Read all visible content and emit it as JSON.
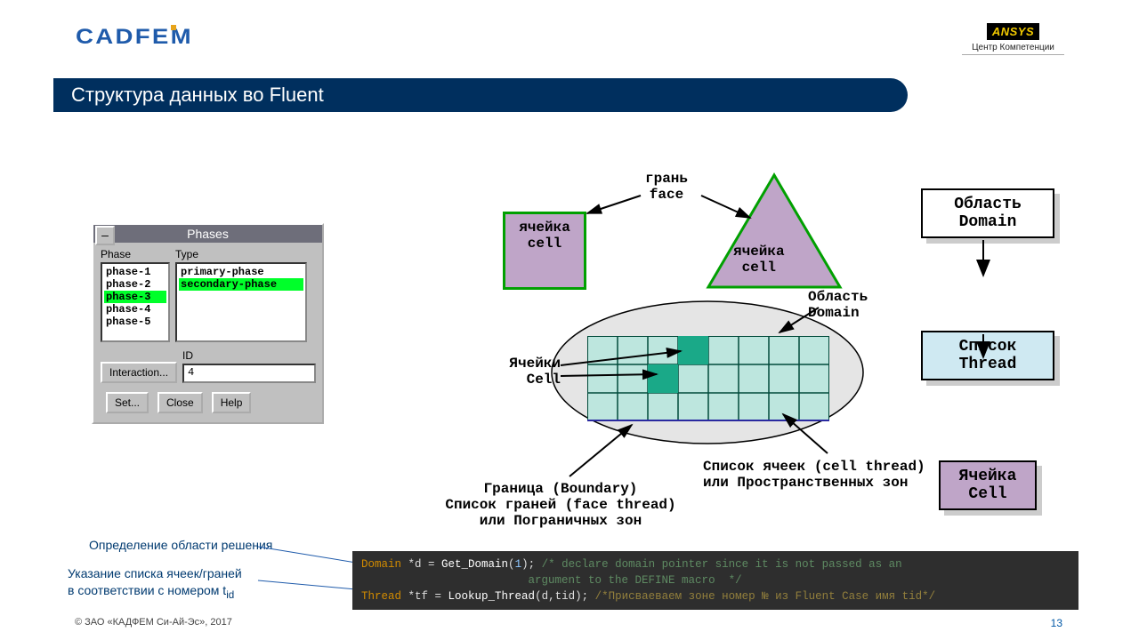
{
  "header": {
    "logo": "CADFEM",
    "partner_box": "ANSYS",
    "partner_sub": "Центр Компетенции"
  },
  "title": "Структура данных во Fluent",
  "dialog": {
    "title": "Phases",
    "phase_label": "Phase",
    "type_label": "Type",
    "phases": [
      "phase-1",
      "phase-2",
      "phase-3",
      "phase-4",
      "phase-5"
    ],
    "phase_selected_index": 2,
    "types": [
      "primary-phase",
      "secondary-phase"
    ],
    "type_selected_index": 1,
    "id_label": "ID",
    "id_value": "4",
    "interaction_btn": "Interaction...",
    "set_btn": "Set...",
    "close_btn": "Close",
    "help_btn": "Help"
  },
  "diagram_top": {
    "cell_left_line1": "ячейка",
    "cell_left_line2": "cell",
    "face_line1": "грань",
    "face_line2": "face",
    "cell_right_line1": "ячейка",
    "cell_right_line2": "cell"
  },
  "hierarchy": {
    "domain_line1": "Область",
    "domain_line2": "Domain",
    "thread_line1": "Список",
    "thread_line2": "Thread",
    "cell_line1": "Ячейка",
    "cell_line2": "Cell"
  },
  "ellipse": {
    "domain_lbl_line1": "Область",
    "domain_lbl_line2": "Domain",
    "cells_lbl_line1": "Ячейки",
    "cells_lbl_line2": "Cell",
    "boundary_line1": "Граница (Boundary)",
    "boundary_line2": "Список граней (face thread)",
    "boundary_line3": "или Пограничных зон",
    "thread_right_line1": "Список ячеек (cell thread)",
    "thread_right_line2": "или Пространственных зон"
  },
  "footnotes": {
    "note1": "Определение области решения",
    "note2_a": "Указание списка ячеек/граней",
    "note2_b": "в соответствии с номером t",
    "note2_sub": "id"
  },
  "code": {
    "l1_type": "Domain",
    "l1_var": " *d = ",
    "l1_func": "Get_Domain",
    "l1_open": "(",
    "l1_arg": "1",
    "l1_close": "); ",
    "l1_comment": "/* declare domain pointer since it is not passed as an",
    "l2_comment": "                         argument to the DEFINE macro  */",
    "l3_type": "Thread",
    "l3_var": " *tf = ",
    "l3_func": "Lookup_Thread",
    "l3_args": "(d,tid); ",
    "l3_comment": "/*Присваеваем зоне номер № из Fluent Case имя tid*/"
  },
  "footer": {
    "copyright": "© ЗАО «КАДФЕМ Си-Ай-Эс», 2017",
    "page": "13"
  }
}
